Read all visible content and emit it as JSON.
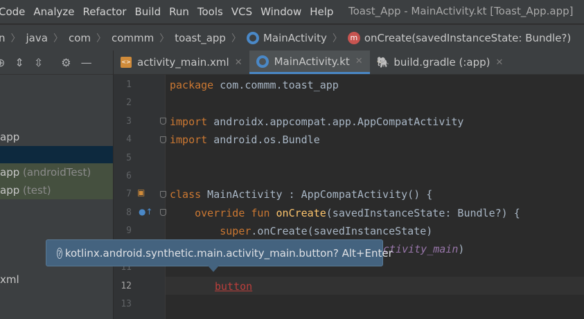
{
  "menu": [
    "Code",
    "Analyze",
    "Refactor",
    "Build",
    "Run",
    "Tools",
    "VCS",
    "Window",
    "Help"
  ],
  "window_title": "Toast_App - MainActivity.kt [Toast_App.app]",
  "breadcrumb": {
    "items": [
      "n",
      "java",
      "com",
      "commm",
      "toast_app",
      "MainActivity",
      "onCreate(savedInstanceState: Bundle?)"
    ],
    "method_icon": "m"
  },
  "sidebar": {
    "rows": [
      {
        "label": "app",
        "suffix": ""
      },
      {
        "label": "",
        "suffix": ""
      },
      {
        "label": "app",
        "suffix": "(androidTest)"
      },
      {
        "label": "app",
        "suffix": "(test)"
      },
      {
        "label": "xml",
        "suffix": ""
      }
    ]
  },
  "tabs": [
    {
      "label": "activity_main.xml",
      "icon": "xml-file-icon"
    },
    {
      "label": "MainActivity.kt",
      "icon": "kotlin-class-icon"
    },
    {
      "label": "build.gradle (:app)",
      "icon": "gradle-icon"
    }
  ],
  "xml_icon_text": "<>",
  "code": {
    "line_numbers": [
      "1",
      "2",
      "3",
      "4",
      "5",
      "6",
      "7",
      "8",
      "9",
      "11",
      "12",
      "13"
    ],
    "l1_kw": "package",
    "l1_rest": " com.commm.toast_app",
    "l3_kw": "import",
    "l3_rest": " androidx.appcompat.app.AppCompatActivity",
    "l4_kw": "import",
    "l4_rest": " android.os.Bundle",
    "l7_kw": "class",
    "l7_rest": " MainActivity : AppCompatActivity() {",
    "l8_kw": "    override fun ",
    "l8_fn": "onCreate",
    "l8_rest": "(savedInstanceState: Bundle?) {",
    "l9_kw": "        super",
    "l9_rest": ".onCreate(savedInstanceState)",
    "l10_tail": "ctivity_main",
    "l10_close": ")",
    "l12_err": "button"
  },
  "tooltip": {
    "text": "kotlinx.android.synthetic.main.activity_main.button? Alt+Enter",
    "icon": "question-icon"
  },
  "colors": {
    "keyword": "#cc7832",
    "function": "#ffc66d",
    "error": "#bc3f3c",
    "tooltip_bg": "#44637f",
    "active_tab_underline": "#4a88c7"
  }
}
